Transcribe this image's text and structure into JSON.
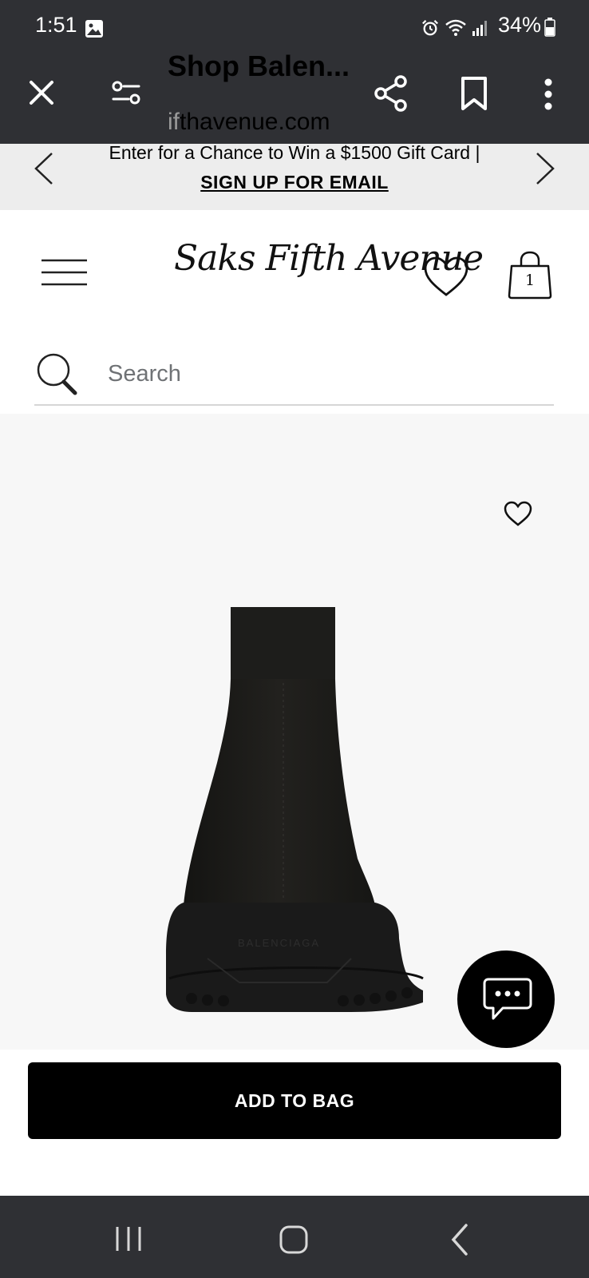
{
  "status_bar": {
    "time": "1:51",
    "battery": "34%"
  },
  "browser": {
    "title": "Shop Balen...",
    "url_dim": "if",
    "url_main": "thavenue.com"
  },
  "promo": {
    "line1": "Enter for a Chance to Win a $1500 Gift Card |",
    "line2": "SIGN UP FOR EMAIL"
  },
  "header": {
    "logo_text": "Saks Fifth Avenue",
    "bag_count": "1"
  },
  "search": {
    "placeholder": "Search"
  },
  "product": {
    "image_label": "BALENCIAGA"
  },
  "actions": {
    "add_to_bag": "ADD TO BAG"
  },
  "colors": {
    "bar_bg": "#2f3034",
    "promo_bg": "#ededed",
    "product_bg": "#f7f7f7",
    "button_bg": "#000000"
  }
}
